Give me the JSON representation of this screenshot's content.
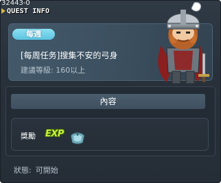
{
  "header": {
    "quest_id": "32443-0",
    "title": "QUEST INFO"
  },
  "quest": {
    "badge": "每週",
    "name": "[每周任务]搜集不安的弓身",
    "level_requirement": "建議等級: 160以上"
  },
  "content": {
    "header": "內容",
    "reward_label": "獎勵",
    "reward_exp_icon_text": "EXP",
    "reward_item_icon": "blue-armor-item-icon"
  },
  "status": {
    "label": "狀態:",
    "value": "可開始"
  },
  "npc": {
    "icon": "knight-npc-portrait"
  },
  "colors": {
    "window_bg": "#28313b",
    "badge_bg": "#6dcce5",
    "exp_green": "#c9f23a"
  }
}
